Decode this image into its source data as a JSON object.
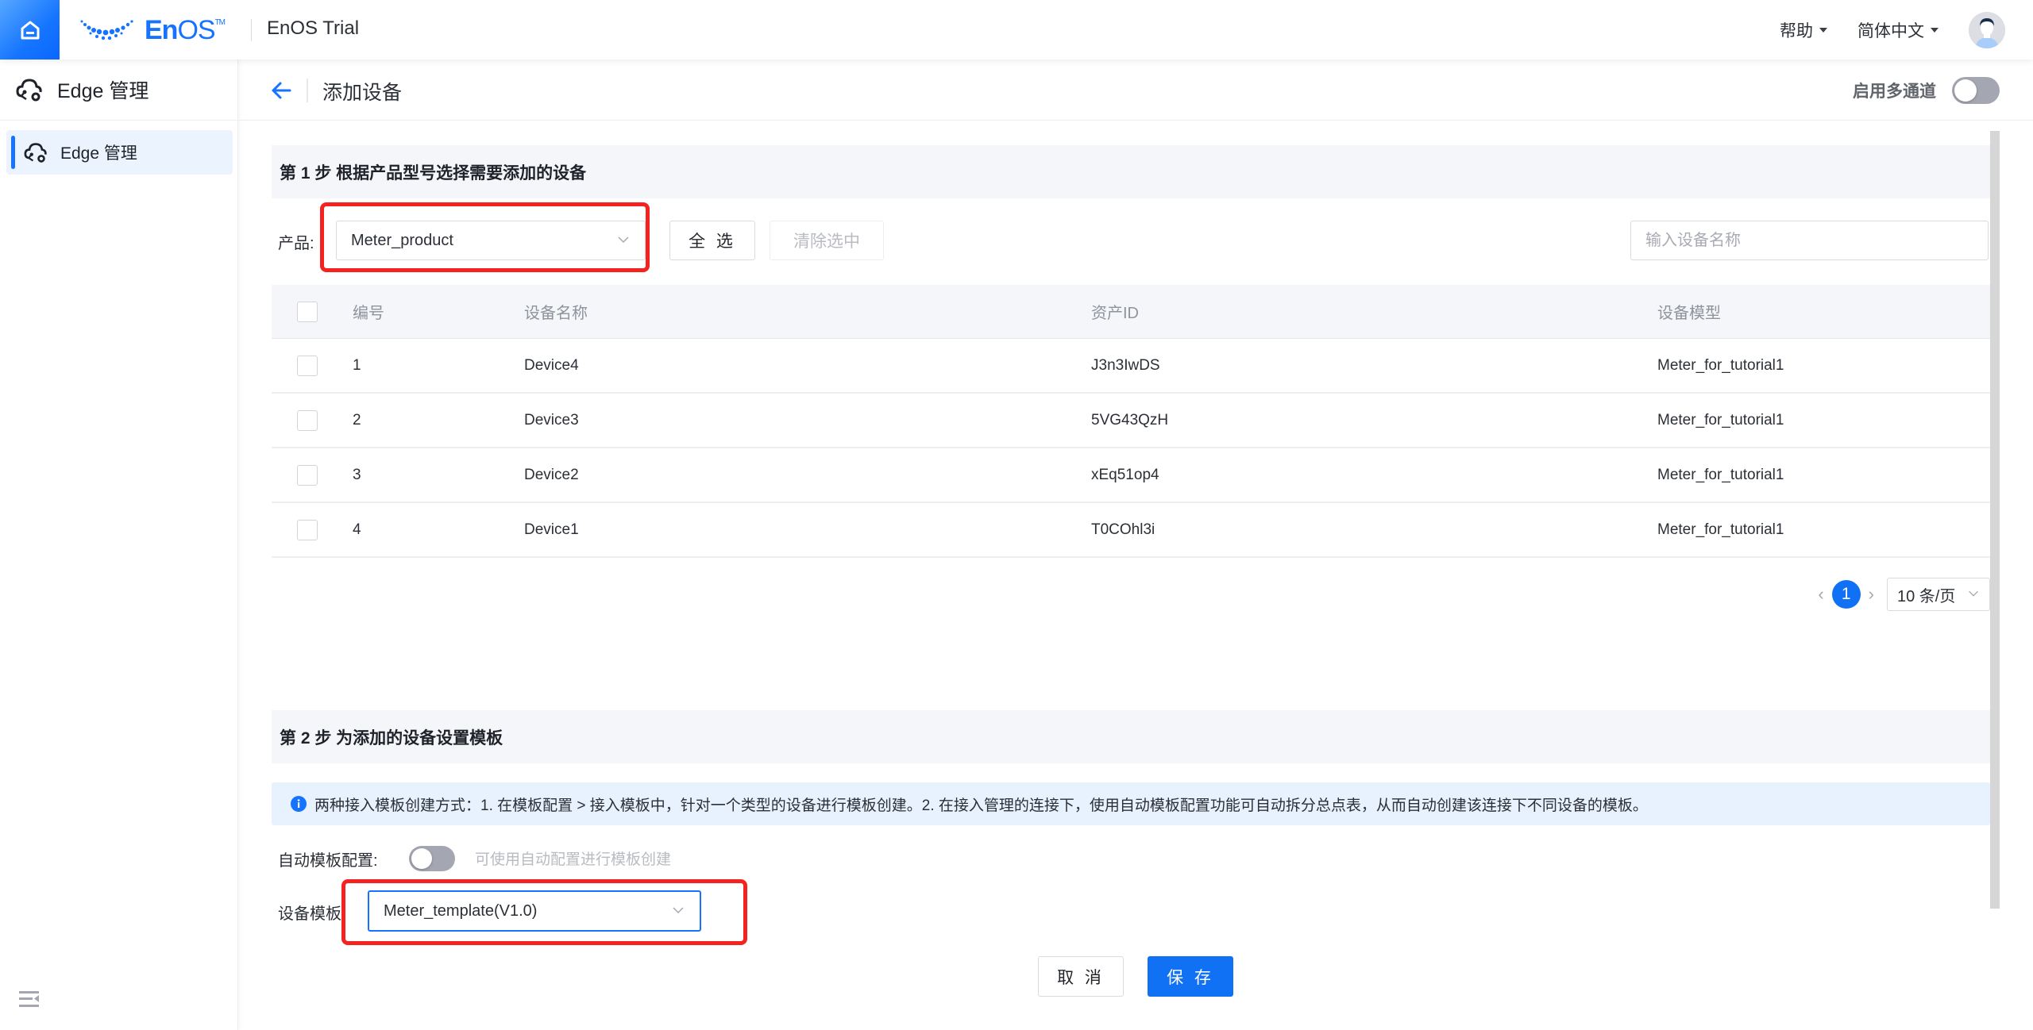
{
  "header": {
    "logo_text": "En",
    "logo_text_os": "OS",
    "logo_tm": "TM",
    "org_name": "EnOS Trial",
    "help_menu": "帮助",
    "language_menu": "简体中文",
    "brand_color": "#1673FF"
  },
  "sidebar": {
    "title": "Edge 管理",
    "items": [
      {
        "label": "Edge 管理",
        "active": true
      }
    ]
  },
  "page": {
    "title": "添加设备",
    "multi_channel_label": "启用多通道",
    "multi_channel_enabled": false
  },
  "step1": {
    "title": "第 1 步 根据产品型号选择需要添加的设备",
    "product_label": "产品:",
    "product_value": "Meter_product",
    "select_all_button": "全 选",
    "clear_selection_button": "清除选中",
    "search_placeholder": "输入设备名称",
    "table": {
      "columns": [
        "编号",
        "设备名称",
        "资产ID",
        "设备模型"
      ],
      "rows": [
        {
          "no": "1",
          "name": "Device4",
          "asset_id": "J3n3IwDS",
          "model": "Meter_for_tutorial1",
          "checked": false
        },
        {
          "no": "2",
          "name": "Device3",
          "asset_id": "5VG43QzH",
          "model": "Meter_for_tutorial1",
          "checked": false
        },
        {
          "no": "3",
          "name": "Device2",
          "asset_id": "xEq51op4",
          "model": "Meter_for_tutorial1",
          "checked": false
        },
        {
          "no": "4",
          "name": "Device1",
          "asset_id": "T0COhl3i",
          "model": "Meter_for_tutorial1",
          "checked": false
        }
      ]
    },
    "pagination": {
      "prev": "‹",
      "current_page": "1",
      "next": "›",
      "page_size": "10 条/页"
    }
  },
  "step2": {
    "title": "第 2 步 为添加的设备设置模板",
    "info_text": "两种接入模板创建方式：1. 在模板配置 > 接入模板中，针对一个类型的设备进行模板创建。2. 在接入管理的连接下，使用自动模板配置功能可自动拆分总点表，从而自动创建该连接下不同设备的模板。",
    "auto_template_label": "自动模板配置:",
    "auto_template_enabled": false,
    "auto_template_hint": "可使用自动配置进行模板创建",
    "device_template_label": "设备模板:",
    "device_template_value": "Meter_template(V1.0)"
  },
  "footer": {
    "cancel_button": "取 消",
    "save_button": "保 存"
  },
  "annotations": {
    "highlight_color": "#F5231F"
  }
}
